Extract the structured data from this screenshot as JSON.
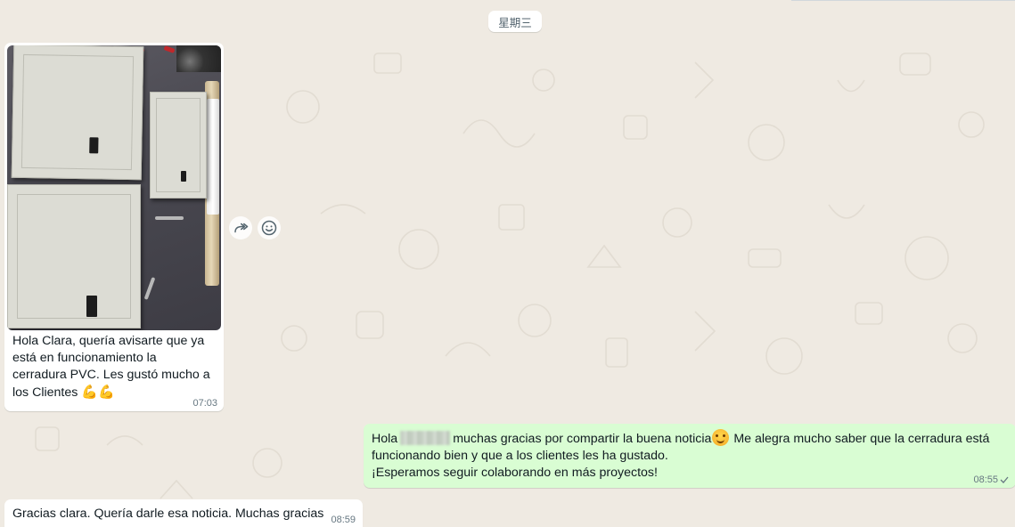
{
  "day_separator": "星期三",
  "messages": {
    "image_message": {
      "caption": "Hola Clara, quería avisarte que ya está en funcionamiento la cerradura PVC. Les gustó mucho a los Clientes",
      "emoji": "💪💪",
      "time": "07:03",
      "image_icon": "photo-of-pvc-panels"
    },
    "outgoing_message": {
      "greeting": "Hola",
      "text_part1": "muchas gracias por compartir la buena noticia",
      "text_part2": " Me alegra mucho saber que la cerradura está funcionando bien y que a los clientes les ha gustado.",
      "text_part3": "¡Esperamos seguir colaborando en más proyectos!",
      "time": "08:55",
      "status_icon": "single-check-icon"
    },
    "last_incoming": {
      "text": "Gracias clara. Quería darle esa noticia. Muchas gracias",
      "time": "08:59"
    }
  },
  "actions": {
    "forward_icon": "forward-icon",
    "react_icon": "emoji-react-icon"
  },
  "colors": {
    "chat_background": "#efeae2",
    "incoming_bubble": "#ffffff",
    "outgoing_bubble": "#d9fdd3",
    "timestamp": "#667781"
  }
}
